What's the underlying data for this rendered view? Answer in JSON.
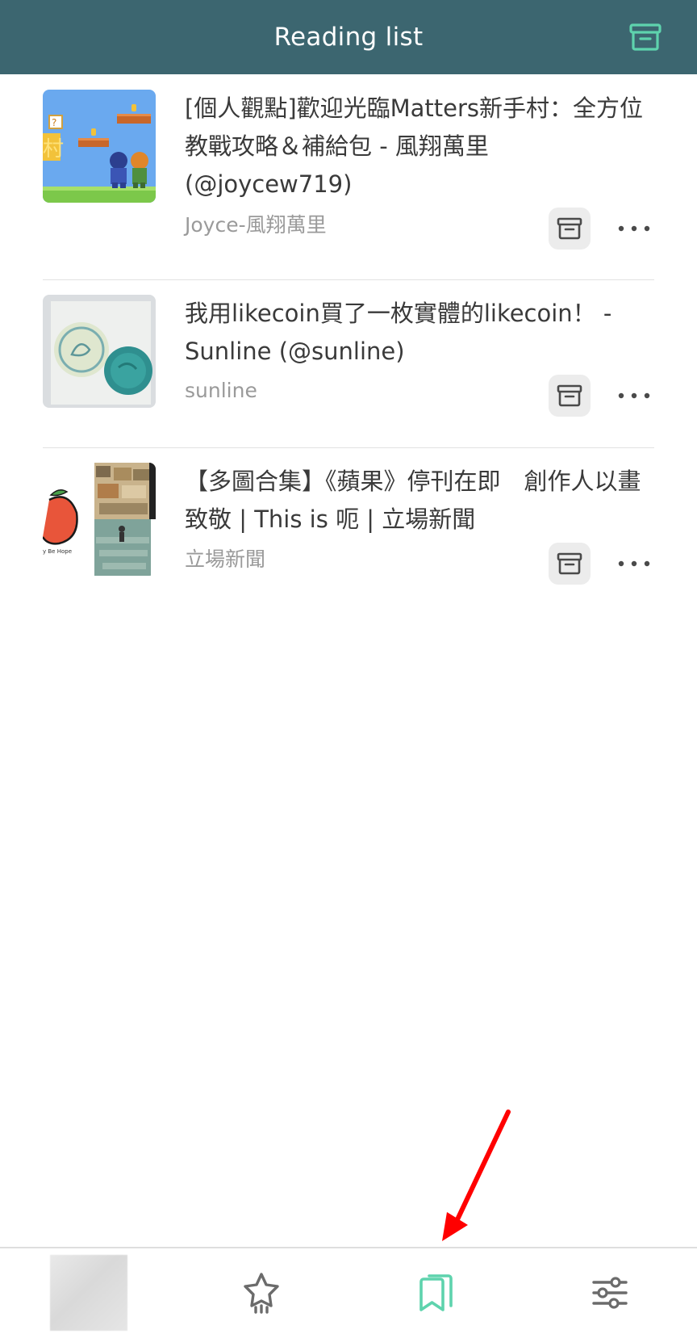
{
  "header": {
    "title": "Reading list",
    "archive_icon": "archive-icon"
  },
  "items": [
    {
      "title": "[個人觀點]歡迎光臨Matters新手村：全方位教戰攻略＆補給包 - 風翔萬里 (@joycew719)",
      "author": "Joyce-風翔萬里",
      "thumbnail": "pixel-game-thumbnail"
    },
    {
      "title": "我用likecoin買了一枚實體的likecoin！ - Sunline (@sunline)",
      "author": "sunline",
      "thumbnail": "wax-seal-thumbnail"
    },
    {
      "title": "【多圖合集】《蘋果》停刊在即　創作人以畫致敬 | This is 呃 | 立場新聞",
      "author": "立場新聞",
      "thumbnail": "apple-collage-thumbnail"
    }
  ],
  "bottom_nav": {
    "active": "bookmarks",
    "items": [
      "avatar",
      "star-icon",
      "bookmarks-icon",
      "settings-sliders-icon"
    ]
  },
  "colors": {
    "header_bg": "#3c6670",
    "accent": "#5ed3ad",
    "annotation": "#ff0000"
  }
}
